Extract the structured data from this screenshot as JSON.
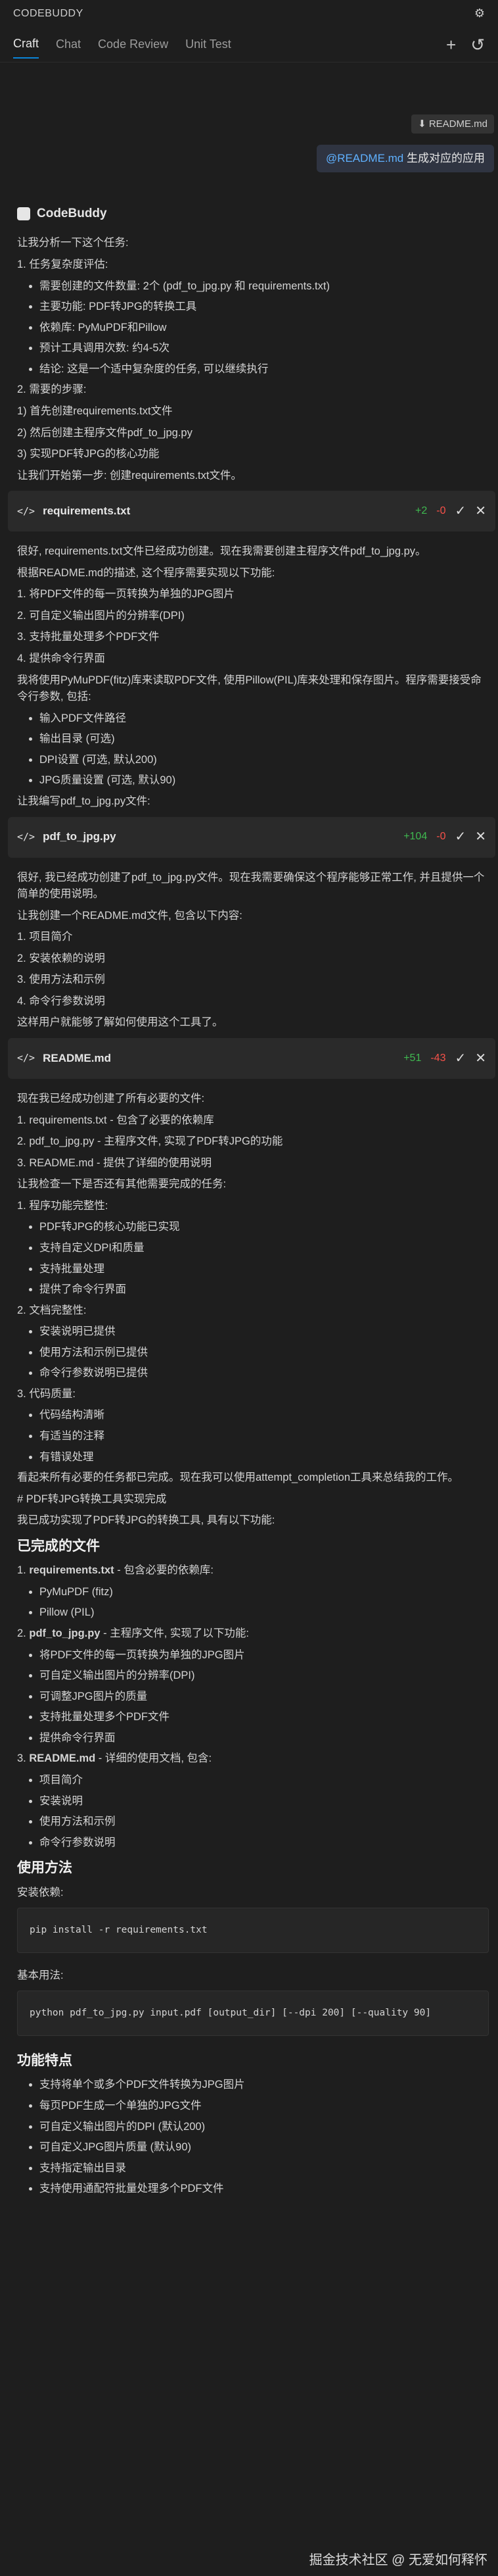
{
  "topbar": {
    "title": "CODEBUDDY"
  },
  "tabs": [
    "Craft",
    "Chat",
    "Code Review",
    "Unit Test"
  ],
  "context_chip": "README.md",
  "user_query": {
    "mention": "@README.md",
    "text": " 生成对应的应用"
  },
  "assistant": {
    "name": "CodeBuddy"
  },
  "intro": "让我分析一下这个任务:",
  "sec1_title": "1. 任务复杂度评估:",
  "sec1_items": [
    "需要创建的文件数量: 2个 (pdf_to_jpg.py 和 requirements.txt)",
    "主要功能: PDF转JPG的转换工具",
    "依赖库: PyMuPDF和Pillow",
    "预计工具调用次数: 约4-5次",
    "结论: 这是一个适中复杂度的任务, 可以继续执行"
  ],
  "sec2_title": "2. 需要的步骤:",
  "sec2_steps": [
    "1) 首先创建requirements.txt文件",
    "2) 然后创建主程序文件pdf_to_jpg.py",
    "3) 实现PDF转JPG的核心功能"
  ],
  "start_text": "让我们开始第一步: 创建requirements.txt文件。",
  "card1": {
    "file": "requirements.txt",
    "add": "+2",
    "del": "-0"
  },
  "p2": "很好, requirements.txt文件已经成功创建。现在我需要创建主程序文件pdf_to_jpg.py。",
  "p3": "根据README.md的描述, 这个程序需要实现以下功能:",
  "func_list": [
    "1. 将PDF文件的每一页转换为单独的JPG图片",
    "2. 可自定义输出图片的分辨率(DPI)",
    "3. 支持批量处理多个PDF文件",
    "4. 提供命令行界面"
  ],
  "p4": "我将使用PyMuPDF(fitz)库来读取PDF文件, 使用Pillow(PIL)库来处理和保存图片。程序需要接受命令行参数, 包括:",
  "params": [
    "输入PDF文件路径",
    "输出目录 (可选)",
    "DPI设置 (可选, 默认200)",
    "JPG质量设置 (可选, 默认90)"
  ],
  "p5": "让我编写pdf_to_jpg.py文件:",
  "card2": {
    "file": "pdf_to_jpg.py",
    "add": "+104",
    "del": "-0"
  },
  "p6": "很好, 我已经成功创建了pdf_to_jpg.py文件。现在我需要确保这个程序能够正常工作, 并且提供一个简单的使用说明。",
  "p7": "让我创建一个README.md文件, 包含以下内容:",
  "readme_list": [
    "1. 项目简介",
    "2. 安装依赖的说明",
    "3. 使用方法和示例",
    "4. 命令行参数说明"
  ],
  "p8": "这样用户就能够了解如何使用这个工具了。",
  "card3": {
    "file": "README.md",
    "add": "+51",
    "del": "-43"
  },
  "p9": "现在我已经成功创建了所有必要的文件:",
  "created_list": [
    "1. requirements.txt - 包含了必要的依赖库",
    "2. pdf_to_jpg.py - 主程序文件, 实现了PDF转JPG的功能",
    "3. README.md - 提供了详细的使用说明"
  ],
  "p10": "让我检查一下是否还有其他需要完成的任务:",
  "check1": "1. 程序功能完整性:",
  "check1_items": [
    "PDF转JPG的核心功能已实现",
    "支持自定义DPI和质量",
    "支持批量处理",
    "提供了命令行界面"
  ],
  "check2": "2. 文档完整性:",
  "check2_items": [
    "安装说明已提供",
    "使用方法和示例已提供",
    "命令行参数说明已提供"
  ],
  "check3": "3. 代码质量:",
  "check3_items": [
    "代码结构清晰",
    "有适当的注释",
    "有错误处理"
  ],
  "p11": "看起来所有必要的任务都已完成。现在我可以使用attempt_completion工具来总结我的工作。",
  "p12": "# PDF转JPG转换工具实现完成",
  "p13": "我已成功实现了PDF转JPG的转换工具, 具有以下功能:",
  "h_done": "已完成的文件",
  "done1_name": "requirements.txt",
  "done1_desc": " - 包含必要的依赖库:",
  "done1_items": [
    "PyMuPDF (fitz)",
    "Pillow (PIL)"
  ],
  "done2_name": "pdf_to_jpg.py",
  "done2_desc": " - 主程序文件, 实现了以下功能:",
  "done2_items": [
    "将PDF文件的每一页转换为单独的JPG图片",
    "可自定义输出图片的分辨率(DPI)",
    "可调整JPG图片的质量",
    "支持批量处理多个PDF文件",
    "提供命令行界面"
  ],
  "done3_name": "README.md",
  "done3_desc": " - 详细的使用文档, 包含:",
  "done3_items": [
    "项目简介",
    "安装说明",
    "使用方法和示例",
    "命令行参数说明"
  ],
  "h_usage": "使用方法",
  "install_label": "安装依赖:",
  "install_cmd": "pip install -r requirements.txt",
  "basic_label": "基本用法:",
  "basic_cmd": "python pdf_to_jpg.py input.pdf [output_dir] [--dpi 200] [--quality 90]",
  "h_features": "功能特点",
  "features": [
    "支持将单个或多个PDF文件转换为JPG图片",
    "每页PDF生成一个单独的JPG文件",
    "可自定义输出图片的DPI (默认200)",
    "可自定义JPG图片质量 (默认90)",
    "支持指定输出目录",
    "支持使用通配符批量处理多个PDF文件"
  ],
  "watermark": "掘金技术社区 @ 无爱如何释怀"
}
